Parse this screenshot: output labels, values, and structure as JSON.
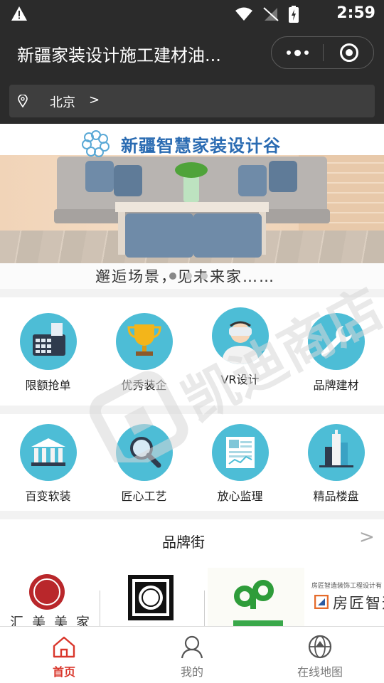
{
  "status_bar": {
    "time": "2:59"
  },
  "nav": {
    "title": "新疆家装设计施工建材油...",
    "more_icon": "more-dots-icon",
    "close_icon": "close-target-icon"
  },
  "location": {
    "city": "北京",
    "arrow": ">"
  },
  "banner": {
    "headline": "新疆智慧家装设计谷",
    "tagline": "邂逅场景，见未来家……",
    "slide_count": 3,
    "active_slide": 1
  },
  "menu_row1": [
    {
      "label": "限额抢单",
      "icon": "cash-register-icon"
    },
    {
      "label": "优秀装企",
      "icon": "trophy-icon"
    },
    {
      "label": "VR设计",
      "icon": "vr-headset-icon"
    },
    {
      "label": "品牌建材",
      "icon": "wrench-icon"
    }
  ],
  "menu_row2": [
    {
      "label": "百变软装",
      "icon": "pillars-icon"
    },
    {
      "label": "匠心工艺",
      "icon": "magnifier-icon"
    },
    {
      "label": "放心监理",
      "icon": "monitor-icon"
    },
    {
      "label": "精品楼盘",
      "icon": "buildings-icon"
    }
  ],
  "brands": {
    "title": "品牌街",
    "more": ">",
    "logos": [
      {
        "name": "汇美美家"
      },
      {
        "name": "framed-emblem-logo"
      },
      {
        "name": "green-dp-logo"
      },
      {
        "name": "房匠智造"
      }
    ],
    "logo4_caption": "房匠智造装饰工程设计有"
  },
  "tabbar": [
    {
      "label": "首页",
      "icon": "home-icon",
      "active": true
    },
    {
      "label": "我的",
      "icon": "person-icon",
      "active": false
    },
    {
      "label": "在线地图",
      "icon": "globe-icon",
      "active": false
    }
  ],
  "watermark": {
    "text": "凯迪商店"
  },
  "colors": {
    "header_bg": "#2b2b2b",
    "accent_red": "#d9362b",
    "icon_circle": "#4dbdd6",
    "headline_blue": "#2a6bb2"
  }
}
